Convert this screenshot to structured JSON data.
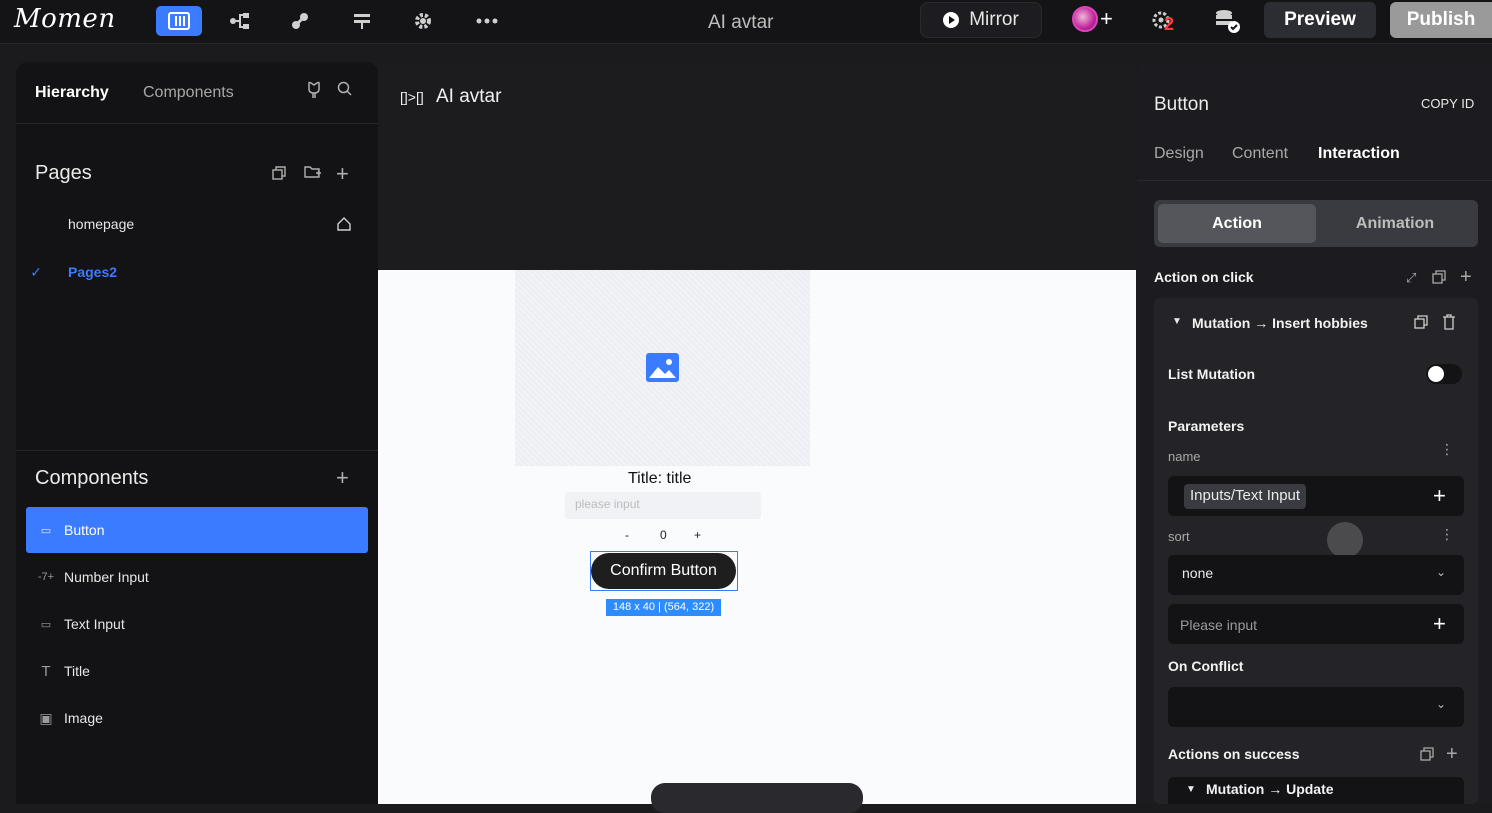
{
  "app": {
    "logo": "Momen",
    "project_title": "AI avtar",
    "mirror_label": "Mirror",
    "preview_label": "Preview",
    "publish_label": "Publish",
    "notification_count": "2"
  },
  "left_panel": {
    "tabs": [
      "Hierarchy",
      "Components"
    ],
    "pages_title": "Pages",
    "pages": [
      {
        "name": "homepage",
        "active": false
      },
      {
        "name": "Pages2",
        "active": true
      }
    ],
    "components_title": "Components",
    "components": [
      {
        "name": "Button",
        "icon_text": "BTN",
        "active": true
      },
      {
        "name": "Number Input",
        "icon_text": "-7+",
        "active": false
      },
      {
        "name": "Text Input",
        "icon_text": "[T",
        "active": false
      },
      {
        "name": "Title",
        "icon_text": "T",
        "active": false
      },
      {
        "name": "Image",
        "icon_text": "▣",
        "active": false
      }
    ]
  },
  "canvas": {
    "breadcrumb_icon": "[]>[]",
    "breadcrumb": "AI avtar",
    "title_text": "Title: title",
    "input_placeholder": "please input",
    "stepper": {
      "minus": "-",
      "value": "0",
      "plus": "+"
    },
    "button_label": "Confirm Button",
    "selection_info": "148 x 40 | (564, 322)"
  },
  "right_panel": {
    "title": "Button",
    "copy_id": "COPY ID",
    "tabs": [
      "Design",
      "Content",
      "Interaction"
    ],
    "active_tab": "Interaction",
    "segments": [
      "Action",
      "Animation"
    ],
    "action_on_click": "Action on click",
    "mutation_title": "Mutation → Insert hobbies",
    "list_mutation": "List Mutation",
    "list_mutation_on": false,
    "parameters": "Parameters",
    "param_name_label": "name",
    "param_name_value": "Inputs/Text Input",
    "param_sort_label": "sort",
    "sort_value": "none",
    "please_input": "Please input",
    "on_conflict": "On Conflict",
    "actions_on_success": "Actions on success",
    "mutation_update": "Mutation → Update"
  },
  "colors": {
    "accent": "#3a7bff",
    "background": "#1b1b1d",
    "panel": "#131315",
    "canvas": "#fafbfd"
  }
}
